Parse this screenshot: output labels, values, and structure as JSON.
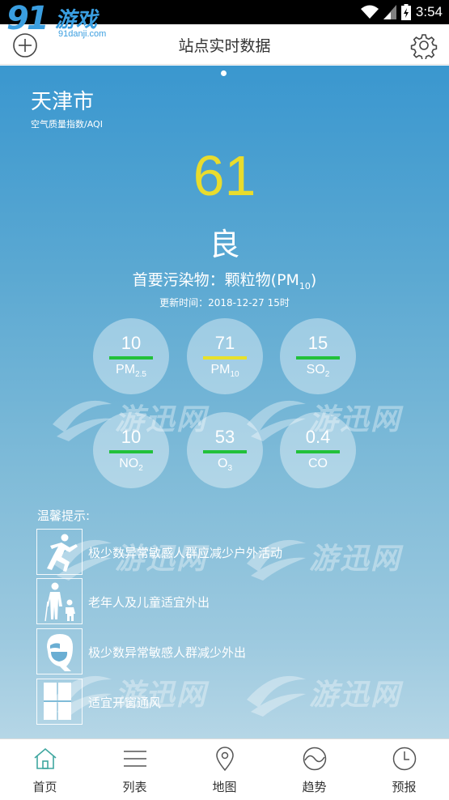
{
  "status_bar": {
    "time": "3:54"
  },
  "brand": {
    "number": "91",
    "word": "游戏",
    "url": "91danji.com"
  },
  "app_bar": {
    "title": "站点实时数据"
  },
  "station": {
    "city": "天津市",
    "aqi_label": "空气质量指数/AQI",
    "aqi_value": "61",
    "aqi_level": "良",
    "primary_pollutant_prefix": "首要污染物：颗粒物(PM",
    "primary_pollutant_sub": "10",
    "primary_pollutant_suffix": ")",
    "update_time": "更新时间：2018-12-27 15时"
  },
  "pollutants": [
    {
      "value": "10",
      "name": "PM",
      "sub": "2.5",
      "color": "#22c13a"
    },
    {
      "value": "71",
      "name": "PM",
      "sub": "10",
      "color": "#e8e12a"
    },
    {
      "value": "15",
      "name": "SO",
      "sub": "2",
      "color": "#22c13a"
    },
    {
      "value": "10",
      "name": "NO",
      "sub": "2",
      "color": "#22c13a"
    },
    {
      "value": "53",
      "name": "O",
      "sub": "3",
      "color": "#22c13a"
    },
    {
      "value": "0.4",
      "name": "CO",
      "sub": "",
      "color": "#22c13a"
    }
  ],
  "tips": {
    "heading": "温馨提示:",
    "items": [
      {
        "icon": "running-person-icon",
        "text": "极少数异常敏感人群应减少户外活动"
      },
      {
        "icon": "elderly-child-icon",
        "text": "老年人及儿童适宜外出"
      },
      {
        "icon": "masked-face-icon",
        "text": "极少数异常敏感人群减少外出"
      },
      {
        "icon": "window-icon",
        "text": "适宜开窗通风"
      }
    ]
  },
  "watermark_text": "游迅网",
  "nav": [
    {
      "icon": "home-icon",
      "label": "首页",
      "active": true
    },
    {
      "icon": "list-icon",
      "label": "列表"
    },
    {
      "icon": "map-pin-icon",
      "label": "地图"
    },
    {
      "icon": "trend-icon",
      "label": "趋势"
    },
    {
      "icon": "clock-icon",
      "label": "预报"
    }
  ],
  "colors": {
    "aqi_value": "#e9dc2d",
    "good": "#22c13a",
    "moderate": "#e8e12a",
    "nav_active": "#3fa7a0"
  }
}
